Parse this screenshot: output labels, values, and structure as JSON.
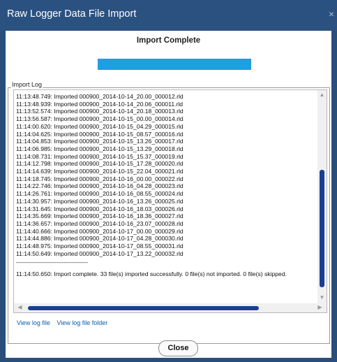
{
  "window": {
    "title": "Raw Logger Data File Import",
    "close_glyph": "×"
  },
  "header": {
    "title": "Import Complete"
  },
  "progress": {
    "fraction": 1.0,
    "color": "#1aa1e0"
  },
  "import_log": {
    "legend": "Import Log",
    "lines": [
      "11:13:48.749: Imported 000900_2014-10-14_20.00_000012.rld",
      "11:13:48.939: Imported 000900_2014-10-14_20.06_000011.rld",
      "11:13:52.574: Imported 000900_2014-10-14_20.18_000013.rld",
      "11:13:56.587: Imported 000900_2014-10-15_00.00_000014.rld",
      "11:14:00.620: Imported 000900_2014-10-15_04.29_000015.rld",
      "11:14:04.625: Imported 000900_2014-10-15_08.57_000016.rld",
      "11:14:04.853: Imported 000900_2014-10-15_13.26_000017.rld",
      "11:14:06.985: Imported 000900_2014-10-15_13.29_000018.rld",
      "11:14:08.731: Imported 000900_2014-10-15_15.37_000019.rld",
      "11:14:12.798: Imported 000900_2014-10-15_17.28_000020.rld",
      "11:14:14.639: Imported 000900_2014-10-15_22.04_000021.rld",
      "11:14:18.745: Imported 000900_2014-10-16_00.00_000022.rld",
      "11:14:22.746: Imported 000900_2014-10-16_04.28_000023.rld",
      "11:14:26.761: Imported 000900_2014-10-16_08.55_000024.rld",
      "11:14:30.957: Imported 000900_2014-10-16_13.26_000025.rld",
      "11:14:31.645: Imported 000900_2014-10-16_18.03_000026.rld",
      "11:14:35.669: Imported 000900_2014-10-16_18.36_000027.rld",
      "11:14:36.657: Imported 000900_2014-10-16_23.07_000028.rld",
      "11:14:40.666: Imported 000900_2014-10-17_00.00_000029.rld",
      "11:14:44.886: Imported 000900_2014-10-17_04.28_000030.rld",
      "11:14:48.975: Imported 000900_2014-10-17_08.55_000031.rld",
      "11:14:50.649: Imported 000900_2014-10-17_13.22_000032.rld"
    ],
    "separator": "------------------------------------",
    "summary": "11:14:50.650: Import complete. 33 file(s) imported successfully. 0 file(s) not imported. 0 file(s) skipped."
  },
  "links": {
    "view_log_file": "View log file",
    "view_log_folder": "View log file folder"
  },
  "buttons": {
    "close": "Close"
  },
  "icons": {
    "scroll_up": "scroll-up-arrow-icon",
    "scroll_down": "scroll-down-arrow-icon",
    "scroll_left": "scroll-left-arrow-icon",
    "scroll_right": "scroll-right-arrow-icon"
  },
  "colors": {
    "titlebar": "#2b5180",
    "frame": "#2a4e7a",
    "scroll_thumb": "#1a3f92",
    "link": "#0b5cad"
  }
}
